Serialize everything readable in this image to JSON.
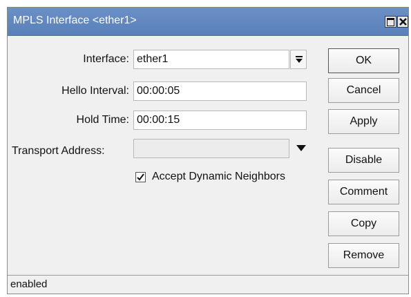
{
  "window": {
    "title": "MPLS Interface <ether1>",
    "controls": {
      "maximize_icon": "maximize-icon",
      "close_icon": "close-icon"
    }
  },
  "form": {
    "interface": {
      "label": "Interface:",
      "value": "ether1"
    },
    "hello_interval": {
      "label": "Hello Interval:",
      "value": "00:00:05"
    },
    "hold_time": {
      "label": "Hold Time:",
      "value": "00:00:15"
    },
    "transport_address": {
      "label": "Transport Address:",
      "value": ""
    },
    "accept_dynamic_neighbors": {
      "label": "Accept Dynamic Neighbors",
      "checked": true
    }
  },
  "buttons": {
    "ok": "OK",
    "cancel": "Cancel",
    "apply": "Apply",
    "disable": "Disable",
    "comment": "Comment",
    "copy": "Copy",
    "remove": "Remove"
  },
  "status": {
    "text": "enabled"
  },
  "colors": {
    "titlebar": "#6b90c6",
    "window_bg": "#f0f0f0"
  }
}
